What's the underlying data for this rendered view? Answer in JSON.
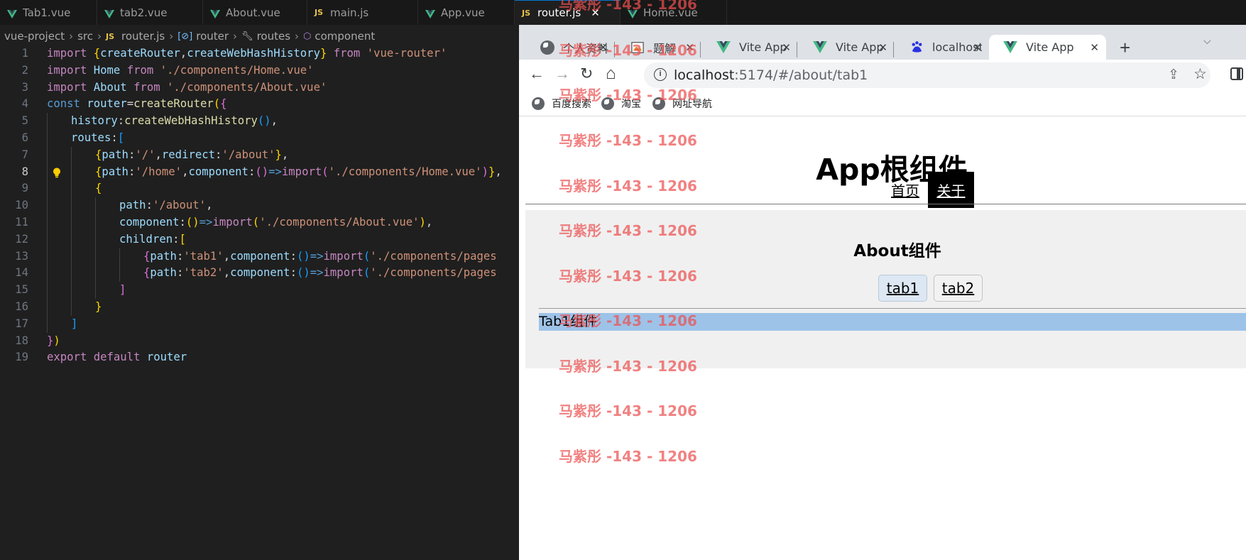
{
  "editor": {
    "tabs": [
      {
        "label": "Tab1.vue",
        "icon": "vue-icon"
      },
      {
        "label": "tab2.vue",
        "icon": "vue-icon"
      },
      {
        "label": "About.vue",
        "icon": "vue-icon"
      },
      {
        "label": "main.js",
        "icon": "js-icon"
      },
      {
        "label": "App.vue",
        "icon": "vue-icon"
      },
      {
        "label": "router.js",
        "icon": "js-icon",
        "active": true
      },
      {
        "label": "Home.vue",
        "icon": "vue-icon"
      }
    ],
    "js_badge": "JS",
    "close_glyph": "✕",
    "breadcrumb": {
      "project": "vue-project",
      "folder": "src",
      "file": "router.js",
      "symbol1": "router",
      "symbol2": "routes",
      "symbol3": "component"
    },
    "line_numbers": [
      "1",
      "2",
      "3",
      "4",
      "5",
      "6",
      "7",
      "8",
      "9",
      "10",
      "11",
      "12",
      "13",
      "14",
      "15",
      "16",
      "17",
      "18",
      "19"
    ],
    "current_line": "8",
    "code": {
      "l1": [
        "import",
        " ",
        "{",
        "createRouter",
        ",",
        "createWebHashHistory",
        "}",
        " ",
        "from",
        " ",
        "'vue-router'"
      ],
      "l2": [
        "import",
        " ",
        "Home",
        " ",
        "from",
        " ",
        "'./components/Home.vue'"
      ],
      "l3": [
        "import",
        " ",
        "About",
        " ",
        "from",
        " ",
        "'./components/About.vue'"
      ],
      "l4": [
        "const",
        " ",
        "router",
        "=",
        "createRouter",
        "(",
        "{"
      ],
      "l5": [
        "history",
        ":",
        "createWebHashHistory",
        "()",
        ","
      ],
      "l6": [
        "routes",
        ":",
        "["
      ],
      "l7": [
        "{",
        "path",
        ":",
        "'/'",
        ",",
        "redirect",
        ":",
        "'/about'",
        "}",
        ","
      ],
      "l8": [
        "{",
        "path",
        ":",
        "'/home'",
        ",",
        "component",
        ":",
        "()",
        "=>",
        "import",
        "(",
        "'./components/Home.vue'",
        ")",
        "}",
        ","
      ],
      "l9": [
        "{"
      ],
      "l10": [
        "path",
        ":",
        "'/about'",
        ","
      ],
      "l11": [
        "component",
        ":",
        "()",
        "=>",
        "import",
        "(",
        "'./components/About.vue'",
        ")",
        ","
      ],
      "l12": [
        "children",
        ":",
        "["
      ],
      "l13": [
        "{",
        "path",
        ":",
        "'tab1'",
        ",",
        "component",
        ":",
        "()",
        "=>",
        "import",
        "(",
        "'./components/pages"
      ],
      "l14": [
        "{",
        "path",
        ":",
        "'tab2'",
        ",",
        "component",
        ":",
        "()",
        "=>",
        "import",
        "(",
        "'./components/pages"
      ],
      "l15": [
        "]"
      ],
      "l16": [
        "}"
      ],
      "l17": [
        "]"
      ],
      "l18": [
        "}",
        ")"
      ],
      "l19": [
        "export",
        " ",
        "default",
        " ",
        "router"
      ]
    }
  },
  "browser": {
    "tabs": [
      {
        "title": "个人资料",
        "icon": "globe-icon"
      },
      {
        "title": "题解",
        "icon": "image-icon"
      },
      {
        "title": "Vite App",
        "icon": "vue-icon"
      },
      {
        "title": "Vite App",
        "icon": "vue-icon"
      },
      {
        "title": "localhost",
        "icon": "baidu-icon"
      },
      {
        "title": "Vite App",
        "icon": "vue-icon",
        "active": true
      }
    ],
    "close_glyph": "✕",
    "new_tab": "+",
    "tab_menu": "⌵",
    "nav": {
      "back": "←",
      "forward": "→",
      "reload": "↻",
      "home": "⌂"
    },
    "info_glyph": "i",
    "url_host": "localhost",
    "url_rest": ":5174/#/about/tab1",
    "share_glyph": "⇪",
    "star_glyph": "☆",
    "bookmarks": [
      "百度搜索",
      "淘宝",
      "网址导航"
    ]
  },
  "page": {
    "app_title": "App根组件",
    "nav_home": "首页",
    "nav_about": "关于",
    "about_title": "About组件",
    "subtab1": "tab1",
    "subtab2": "tab2",
    "tab1_content": "Tab1组件"
  },
  "watermark": "马紫彤 -143 - 1206",
  "colors": {
    "keyword_purple": "#c586c0",
    "keyword_blue": "#569cd6",
    "variable": "#9cdcfe",
    "function": "#dcdcaa",
    "string": "#ce9178",
    "bracket_gold": "#ffd700",
    "active_link_bg": "#000000",
    "selection_blue": "#9ec3e8",
    "watermark_red": "#ec5050"
  }
}
